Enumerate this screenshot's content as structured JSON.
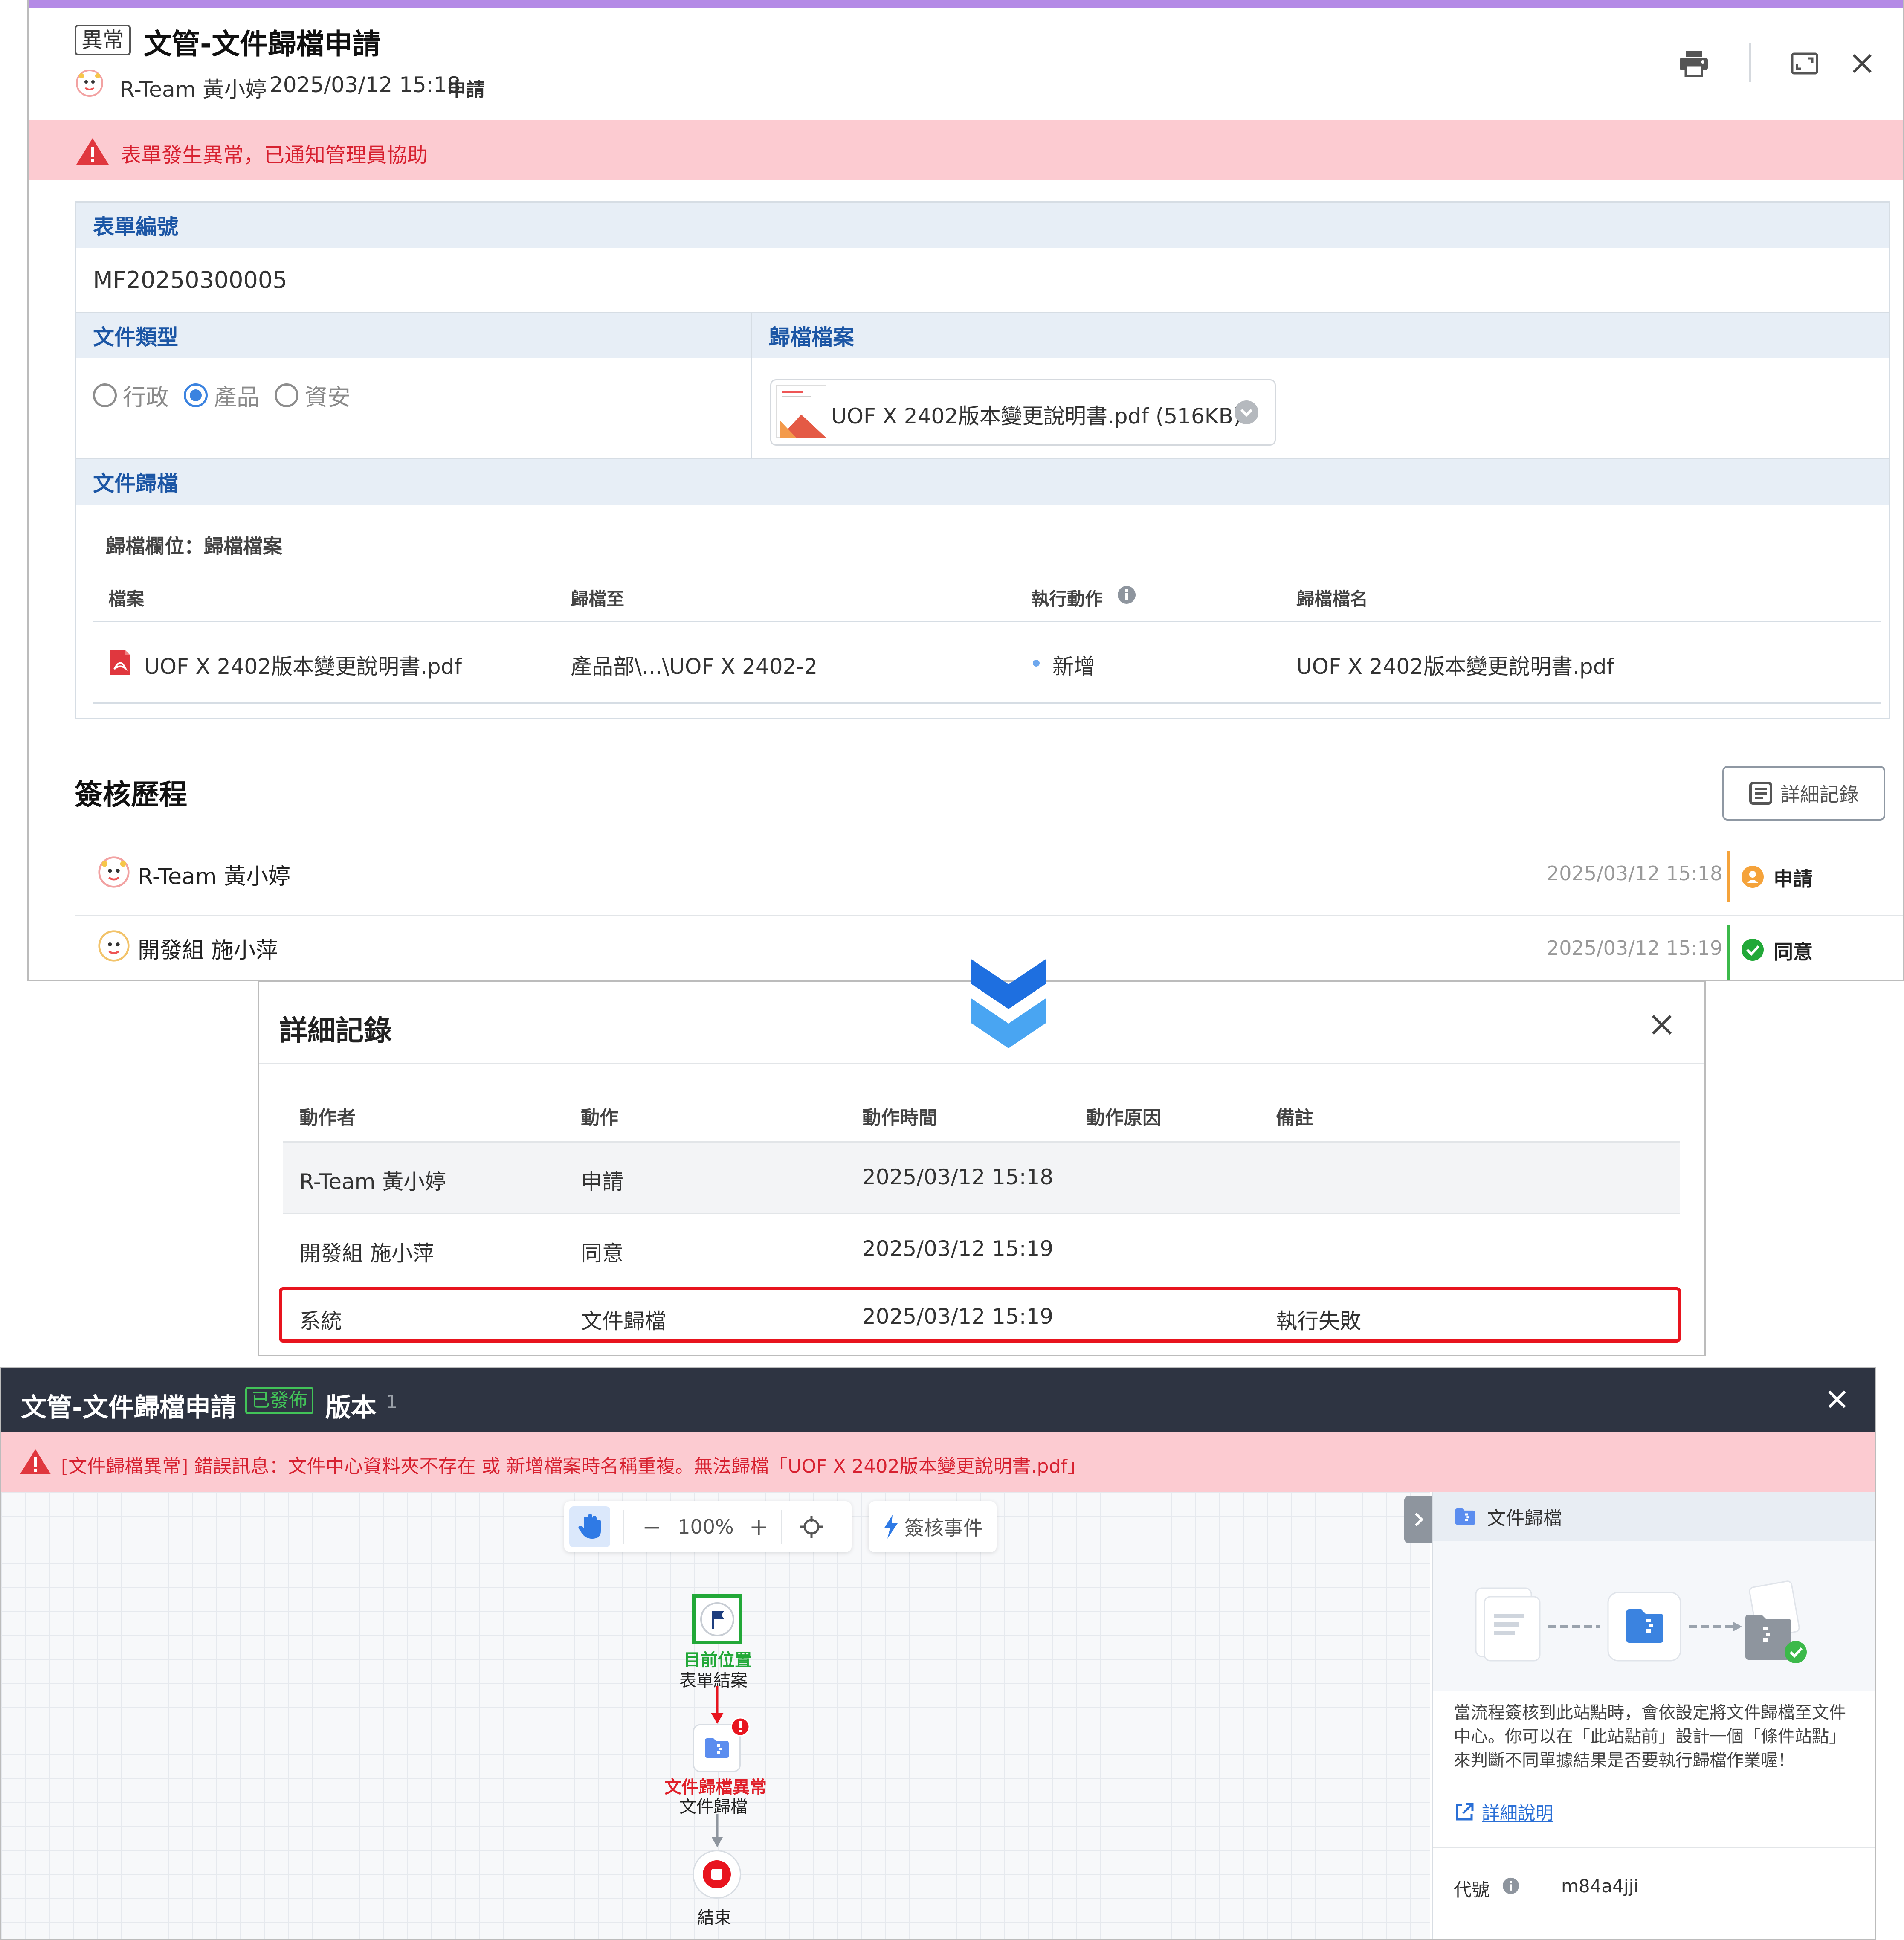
{
  "form": {
    "status_badge": "異常",
    "title": "文管-文件歸檔申請",
    "applicant": "R-Team 黃小婷",
    "datetime": "2025/03/12 15:18",
    "action": "申請",
    "warning": "表單發生異常，已通知管理員協助",
    "form_no_label": "表單編號",
    "form_no_value": "MF20250300005",
    "doc_type_label": "文件類型",
    "doc_type_options": [
      "行政",
      "產品",
      "資安"
    ],
    "doc_type_selected": "產品",
    "archive_file_label": "歸檔檔案",
    "archive_file_name": "UOF X 2402版本變更說明書.pdf (516KB)",
    "archive_section_label": "文件歸檔",
    "archive_field": "歸檔欄位：歸檔檔案",
    "table_headers": [
      "檔案",
      "歸檔至",
      "執行動作",
      "歸檔檔名"
    ],
    "table_row": {
      "file": "UOF X 2402版本變更說明書.pdf",
      "target": "產品部\\...\\UOF X 2402-2",
      "action": "新增",
      "archive_name": "UOF X 2402版本變更說明書.pdf"
    }
  },
  "signoff": {
    "title": "簽核歷程",
    "detail_button": "詳細記錄",
    "rows": [
      {
        "name": "R-Team 黃小婷",
        "time": "2025/03/12 15:18",
        "action": "申請"
      },
      {
        "name": "開發組 施小萍",
        "time": "2025/03/12 15:19",
        "action": "同意"
      }
    ]
  },
  "detail_dialog": {
    "title": "詳細記錄",
    "headers": [
      "動作者",
      "動作",
      "動作時間",
      "動作原因",
      "備註"
    ],
    "rows": [
      {
        "actor": "R-Team 黃小婷",
        "action": "申請",
        "time": "2025/03/12 15:18",
        "reason": "",
        "note": ""
      },
      {
        "actor": "開發組 施小萍",
        "action": "同意",
        "time": "2025/03/12 15:19",
        "reason": "",
        "note": ""
      },
      {
        "actor": "系統",
        "action": "文件歸檔",
        "time": "2025/03/12 15:19",
        "reason": "",
        "note": "執行失敗"
      }
    ]
  },
  "flow": {
    "title": "文管-文件歸檔申請",
    "published_badge": "已發佈",
    "version_label": "版本",
    "version_number": "1",
    "error_message": "[文件歸檔異常] 錯誤訊息：文件中心資料夾不存在 或 新增檔案時名稱重複。無法歸檔「UOF X 2402版本變更說明書.pdf」",
    "zoom": "100%",
    "events_button": "簽核事件",
    "nodes": {
      "current_label": "目前位置",
      "form_end": "表單結案",
      "error_label": "文件歸檔異常",
      "archive": "文件歸檔",
      "end": "結束"
    },
    "side_panel": {
      "title": "文件歸檔",
      "description": "當流程簽核到此站點時，會依設定將文件歸檔至文件中心。你可以在「此站點前」設計一個「條件站點」來判斷不同單據結果是否要執行歸檔作業喔！",
      "link": "詳細說明",
      "code_label": "代號",
      "code_value": "m84a4jji"
    }
  },
  "colors": {
    "accent_purple": "#b48ae6",
    "warning_bg": "#fccbd1",
    "warning_text": "#d72130",
    "link_blue": "#1c56a5",
    "success_green": "#42c358",
    "error_red": "#e0202a"
  }
}
